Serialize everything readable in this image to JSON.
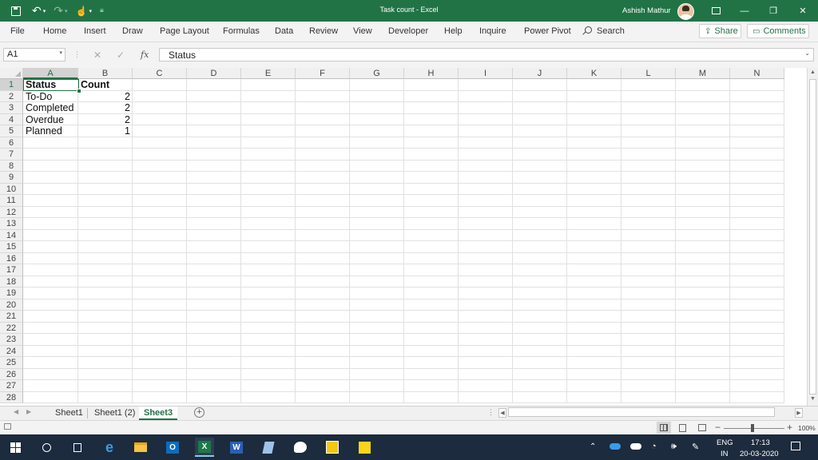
{
  "window": {
    "title": "Task count  -  Excel",
    "user_name": "Ashish Mathur"
  },
  "colors": {
    "brand": "#217346",
    "taskbar": "#1c2b3d"
  },
  "ribbon": {
    "tabs": [
      "File",
      "Home",
      "Insert",
      "Draw",
      "Page Layout",
      "Formulas",
      "Data",
      "Review",
      "View",
      "Developer",
      "Help",
      "Inquire",
      "Power Pivot"
    ],
    "search_label": "Search",
    "share_label": "Share",
    "comments_label": "Comments"
  },
  "formula_bar": {
    "name_box": "A1",
    "fx": "fx",
    "formula": "Status"
  },
  "grid": {
    "columns": [
      "A",
      "B",
      "C",
      "D",
      "E",
      "F",
      "G",
      "H",
      "I",
      "J",
      "K",
      "L",
      "M",
      "N"
    ],
    "rows": [
      "1",
      "2",
      "3",
      "4",
      "5",
      "6",
      "7",
      "8",
      "9",
      "10",
      "11",
      "12",
      "13",
      "14",
      "15",
      "16",
      "17",
      "18",
      "19",
      "20",
      "21",
      "22",
      "23",
      "24",
      "25",
      "26",
      "27",
      "28"
    ],
    "data": [
      [
        "Status",
        "Count"
      ],
      [
        "To-Do",
        "2"
      ],
      [
        "Completed",
        "2"
      ],
      [
        "Overdue",
        "2"
      ],
      [
        "Planned",
        "1"
      ]
    ]
  },
  "sheets": [
    "Sheet1",
    "Sheet1 (2)",
    "Sheet3"
  ],
  "active_sheet": "Sheet3",
  "status_bar": {
    "zoom": "100%"
  },
  "taskbar": {
    "language": "ENG",
    "region": "IN",
    "time": "17:13",
    "date": "20-03-2020"
  }
}
